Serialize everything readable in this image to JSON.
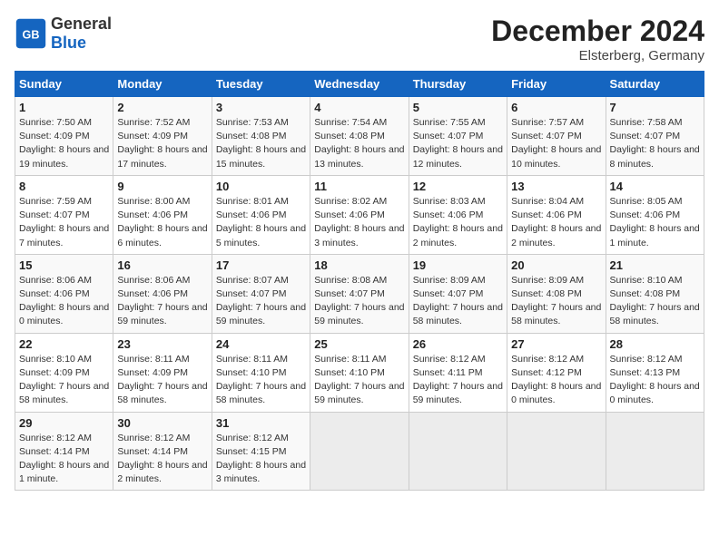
{
  "header": {
    "logo_general": "General",
    "logo_blue": "Blue",
    "title": "December 2024",
    "subtitle": "Elsterberg, Germany"
  },
  "columns": [
    "Sunday",
    "Monday",
    "Tuesday",
    "Wednesday",
    "Thursday",
    "Friday",
    "Saturday"
  ],
  "weeks": [
    [
      {
        "day": "1",
        "info": "Sunrise: 7:50 AM\nSunset: 4:09 PM\nDaylight: 8 hours and 19 minutes."
      },
      {
        "day": "2",
        "info": "Sunrise: 7:52 AM\nSunset: 4:09 PM\nDaylight: 8 hours and 17 minutes."
      },
      {
        "day": "3",
        "info": "Sunrise: 7:53 AM\nSunset: 4:08 PM\nDaylight: 8 hours and 15 minutes."
      },
      {
        "day": "4",
        "info": "Sunrise: 7:54 AM\nSunset: 4:08 PM\nDaylight: 8 hours and 13 minutes."
      },
      {
        "day": "5",
        "info": "Sunrise: 7:55 AM\nSunset: 4:07 PM\nDaylight: 8 hours and 12 minutes."
      },
      {
        "day": "6",
        "info": "Sunrise: 7:57 AM\nSunset: 4:07 PM\nDaylight: 8 hours and 10 minutes."
      },
      {
        "day": "7",
        "info": "Sunrise: 7:58 AM\nSunset: 4:07 PM\nDaylight: 8 hours and 8 minutes."
      }
    ],
    [
      {
        "day": "8",
        "info": "Sunrise: 7:59 AM\nSunset: 4:07 PM\nDaylight: 8 hours and 7 minutes."
      },
      {
        "day": "9",
        "info": "Sunrise: 8:00 AM\nSunset: 4:06 PM\nDaylight: 8 hours and 6 minutes."
      },
      {
        "day": "10",
        "info": "Sunrise: 8:01 AM\nSunset: 4:06 PM\nDaylight: 8 hours and 5 minutes."
      },
      {
        "day": "11",
        "info": "Sunrise: 8:02 AM\nSunset: 4:06 PM\nDaylight: 8 hours and 3 minutes."
      },
      {
        "day": "12",
        "info": "Sunrise: 8:03 AM\nSunset: 4:06 PM\nDaylight: 8 hours and 2 minutes."
      },
      {
        "day": "13",
        "info": "Sunrise: 8:04 AM\nSunset: 4:06 PM\nDaylight: 8 hours and 2 minutes."
      },
      {
        "day": "14",
        "info": "Sunrise: 8:05 AM\nSunset: 4:06 PM\nDaylight: 8 hours and 1 minute."
      }
    ],
    [
      {
        "day": "15",
        "info": "Sunrise: 8:06 AM\nSunset: 4:06 PM\nDaylight: 8 hours and 0 minutes."
      },
      {
        "day": "16",
        "info": "Sunrise: 8:06 AM\nSunset: 4:06 PM\nDaylight: 7 hours and 59 minutes."
      },
      {
        "day": "17",
        "info": "Sunrise: 8:07 AM\nSunset: 4:07 PM\nDaylight: 7 hours and 59 minutes."
      },
      {
        "day": "18",
        "info": "Sunrise: 8:08 AM\nSunset: 4:07 PM\nDaylight: 7 hours and 59 minutes."
      },
      {
        "day": "19",
        "info": "Sunrise: 8:09 AM\nSunset: 4:07 PM\nDaylight: 7 hours and 58 minutes."
      },
      {
        "day": "20",
        "info": "Sunrise: 8:09 AM\nSunset: 4:08 PM\nDaylight: 7 hours and 58 minutes."
      },
      {
        "day": "21",
        "info": "Sunrise: 8:10 AM\nSunset: 4:08 PM\nDaylight: 7 hours and 58 minutes."
      }
    ],
    [
      {
        "day": "22",
        "info": "Sunrise: 8:10 AM\nSunset: 4:09 PM\nDaylight: 7 hours and 58 minutes."
      },
      {
        "day": "23",
        "info": "Sunrise: 8:11 AM\nSunset: 4:09 PM\nDaylight: 7 hours and 58 minutes."
      },
      {
        "day": "24",
        "info": "Sunrise: 8:11 AM\nSunset: 4:10 PM\nDaylight: 7 hours and 58 minutes."
      },
      {
        "day": "25",
        "info": "Sunrise: 8:11 AM\nSunset: 4:10 PM\nDaylight: 7 hours and 59 minutes."
      },
      {
        "day": "26",
        "info": "Sunrise: 8:12 AM\nSunset: 4:11 PM\nDaylight: 7 hours and 59 minutes."
      },
      {
        "day": "27",
        "info": "Sunrise: 8:12 AM\nSunset: 4:12 PM\nDaylight: 8 hours and 0 minutes."
      },
      {
        "day": "28",
        "info": "Sunrise: 8:12 AM\nSunset: 4:13 PM\nDaylight: 8 hours and 0 minutes."
      }
    ],
    [
      {
        "day": "29",
        "info": "Sunrise: 8:12 AM\nSunset: 4:14 PM\nDaylight: 8 hours and 1 minute."
      },
      {
        "day": "30",
        "info": "Sunrise: 8:12 AM\nSunset: 4:14 PM\nDaylight: 8 hours and 2 minutes."
      },
      {
        "day": "31",
        "info": "Sunrise: 8:12 AM\nSunset: 4:15 PM\nDaylight: 8 hours and 3 minutes."
      },
      {
        "day": "",
        "info": ""
      },
      {
        "day": "",
        "info": ""
      },
      {
        "day": "",
        "info": ""
      },
      {
        "day": "",
        "info": ""
      }
    ]
  ]
}
